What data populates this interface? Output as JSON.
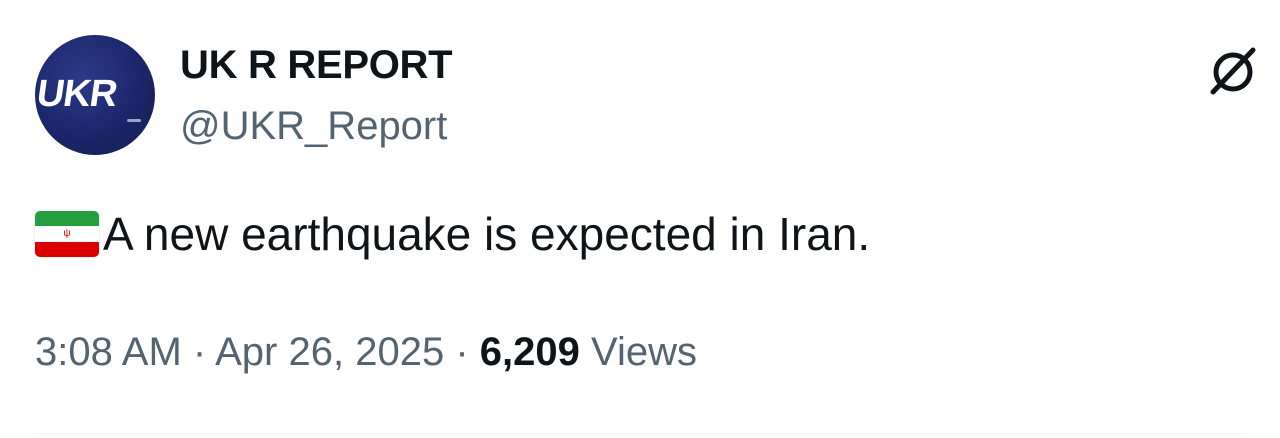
{
  "author": {
    "display_name": "UK R REPORT",
    "handle": "@UKR_Report",
    "avatar_text": "UKR",
    "avatar_color": "#1a2566"
  },
  "icons": {
    "grok": "grok-icon",
    "flag": "iran-flag-emoji"
  },
  "tweet": {
    "text": "A new earthquake is expected in Iran."
  },
  "meta": {
    "time": "3:08 AM",
    "separator": "·",
    "date": "Apr 26, 2025",
    "views_count": "6,209",
    "views_label": "Views"
  },
  "colors": {
    "text_primary": "#0f1419",
    "text_secondary": "#536471"
  }
}
